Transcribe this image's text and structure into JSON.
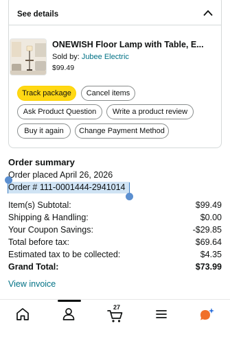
{
  "details": {
    "header_label": "See details",
    "product_title": "ONEWISH Floor Lamp with Table, E...",
    "sold_by_prefix": "Sold by: ",
    "seller": "Jubee Electric",
    "price": "$99.49",
    "buttons": {
      "track": "Track package",
      "cancel": "Cancel items",
      "ask": "Ask Product Question",
      "review": "Write a product review",
      "buy_again": "Buy it again",
      "change_payment": "Change Payment Method"
    }
  },
  "summary": {
    "title": "Order summary",
    "placed": "Order placed April 26, 2026",
    "order_number": "Order # 111-0001444-2941014",
    "rows": [
      {
        "label": "Item(s) Subtotal:",
        "value": "$99.49"
      },
      {
        "label": "Shipping & Handling:",
        "value": "$0.00"
      },
      {
        "label": "Your Coupon Savings:",
        "value": "-$29.85"
      },
      {
        "label": "Total before tax:",
        "value": "$69.64"
      },
      {
        "label": "Estimated tax to be collected:",
        "value": "$4.35"
      },
      {
        "label": "Grand Total:",
        "value": "$73.99"
      }
    ],
    "invoice_link": "View invoice"
  },
  "nav": {
    "cart_count": "27",
    "items": [
      "home-icon",
      "account-icon",
      "cart-icon",
      "menu-icon",
      "rufus-icon"
    ]
  },
  "colors": {
    "link": "#007185",
    "primary_button": "#ffd814",
    "selection": "#cfe3f4",
    "ai_orange": "#f0702a",
    "ai_blue": "#2a6fdb"
  }
}
